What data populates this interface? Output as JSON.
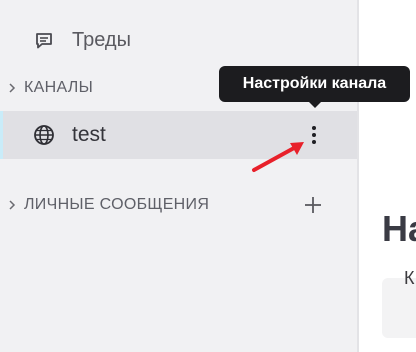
{
  "sidebar": {
    "threads_label": "Треды",
    "channels_section": "КАНАЛЫ",
    "channels": [
      {
        "name": "test",
        "icon": "globe-icon",
        "active": true
      }
    ],
    "dm_section": "ЛИЧНЫЕ СООБЩЕНИЯ"
  },
  "tooltip": {
    "text": "Настройки канала"
  },
  "main": {
    "heading_partial": "На",
    "box_text_partial": "К"
  },
  "colors": {
    "sidebar_bg": "#f1f1f3",
    "active_row_bg": "#e0e0e4",
    "active_indicator": "#c9ecf9",
    "tooltip_bg": "#1c1c1f",
    "annotation_arrow": "#e8202a"
  }
}
